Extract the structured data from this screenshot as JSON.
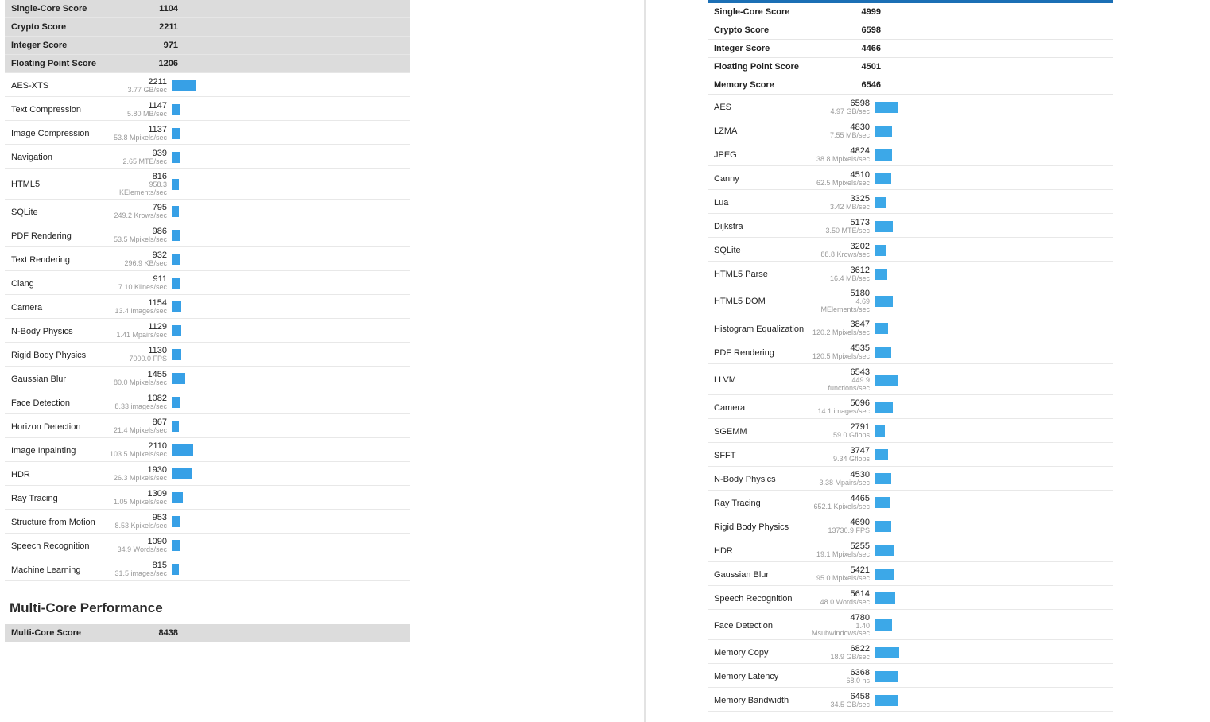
{
  "left": {
    "summary": [
      {
        "label": "Single-Core Score",
        "value": "1104"
      },
      {
        "label": "Crypto Score",
        "value": "2211"
      },
      {
        "label": "Integer Score",
        "value": "971"
      },
      {
        "label": "Floating Point Score",
        "value": "1206"
      }
    ],
    "benchmarks": [
      {
        "name": "AES-XTS",
        "score": "2211",
        "unit": "3.77 GB/sec",
        "bar": 30
      },
      {
        "name": "Text Compression",
        "score": "1147",
        "unit": "5.80 MB/sec",
        "bar": 11
      },
      {
        "name": "Image Compression",
        "score": "1137",
        "unit": "53.8 Mpixels/sec",
        "bar": 11
      },
      {
        "name": "Navigation",
        "score": "939",
        "unit": "2.65 MTE/sec",
        "bar": 11
      },
      {
        "name": "HTML5",
        "score": "816",
        "unit": "958.3 KElements/sec",
        "bar": 9
      },
      {
        "name": "SQLite",
        "score": "795",
        "unit": "249.2 Krows/sec",
        "bar": 9
      },
      {
        "name": "PDF Rendering",
        "score": "986",
        "unit": "53.5 Mpixels/sec",
        "bar": 11
      },
      {
        "name": "Text Rendering",
        "score": "932",
        "unit": "296.9 KB/sec",
        "bar": 11
      },
      {
        "name": "Clang",
        "score": "911",
        "unit": "7.10 Klines/sec",
        "bar": 11
      },
      {
        "name": "Camera",
        "score": "1154",
        "unit": "13.4 images/sec",
        "bar": 12
      },
      {
        "name": "N-Body Physics",
        "score": "1129",
        "unit": "1.41 Mpairs/sec",
        "bar": 12
      },
      {
        "name": "Rigid Body Physics",
        "score": "1130",
        "unit": "7000.0 FPS",
        "bar": 12
      },
      {
        "name": "Gaussian Blur",
        "score": "1455",
        "unit": "80.0 Mpixels/sec",
        "bar": 17
      },
      {
        "name": "Face Detection",
        "score": "1082",
        "unit": "8.33 images/sec",
        "bar": 11
      },
      {
        "name": "Horizon Detection",
        "score": "867",
        "unit": "21.4 Mpixels/sec",
        "bar": 9
      },
      {
        "name": "Image Inpainting",
        "score": "2110",
        "unit": "103.5 Mpixels/sec",
        "bar": 27
      },
      {
        "name": "HDR",
        "score": "1930",
        "unit": "26.3 Mpixels/sec",
        "bar": 25
      },
      {
        "name": "Ray Tracing",
        "score": "1309",
        "unit": "1.05 Mpixels/sec",
        "bar": 14
      },
      {
        "name": "Structure from Motion",
        "score": "953",
        "unit": "8.53 Kpixels/sec",
        "bar": 11
      },
      {
        "name": "Speech Recognition",
        "score": "1090",
        "unit": "34.9 Words/sec",
        "bar": 11
      },
      {
        "name": "Machine Learning",
        "score": "815",
        "unit": "31.5 images/sec",
        "bar": 9
      }
    ],
    "multi_title": "Multi-Core Performance",
    "multi_summary": [
      {
        "label": "Multi-Core Score",
        "value": "8438"
      }
    ]
  },
  "right": {
    "summary": [
      {
        "label": "Single-Core Score",
        "value": "4999"
      },
      {
        "label": "Crypto Score",
        "value": "6598"
      },
      {
        "label": "Integer Score",
        "value": "4466"
      },
      {
        "label": "Floating Point Score",
        "value": "4501"
      },
      {
        "label": "Memory Score",
        "value": "6546"
      }
    ],
    "benchmarks": [
      {
        "name": "AES",
        "score": "6598",
        "unit": "4.97 GB/sec",
        "bar": 30
      },
      {
        "name": "LZMA",
        "score": "4830",
        "unit": "7.55 MB/sec",
        "bar": 22
      },
      {
        "name": "JPEG",
        "score": "4824",
        "unit": "38.8 Mpixels/sec",
        "bar": 22
      },
      {
        "name": "Canny",
        "score": "4510",
        "unit": "62.5 Mpixels/sec",
        "bar": 21
      },
      {
        "name": "Lua",
        "score": "3325",
        "unit": "3.42 MB/sec",
        "bar": 15
      },
      {
        "name": "Dijkstra",
        "score": "5173",
        "unit": "3.50 MTE/sec",
        "bar": 23
      },
      {
        "name": "SQLite",
        "score": "3202",
        "unit": "88.8 Krows/sec",
        "bar": 15
      },
      {
        "name": "HTML5 Parse",
        "score": "3612",
        "unit": "16.4 MB/sec",
        "bar": 16
      },
      {
        "name": "HTML5 DOM",
        "score": "5180",
        "unit": "4.69 MElements/sec",
        "bar": 23
      },
      {
        "name": "Histogram Equalization",
        "score": "3847",
        "unit": "120.2 Mpixels/sec",
        "bar": 17
      },
      {
        "name": "PDF Rendering",
        "score": "4535",
        "unit": "120.5 Mpixels/sec",
        "bar": 21
      },
      {
        "name": "LLVM",
        "score": "6543",
        "unit": "449.9 functions/sec",
        "bar": 30
      },
      {
        "name": "Camera",
        "score": "5096",
        "unit": "14.1 images/sec",
        "bar": 23
      },
      {
        "name": "SGEMM",
        "score": "2791",
        "unit": "59.0 Gflops",
        "bar": 13
      },
      {
        "name": "SFFT",
        "score": "3747",
        "unit": "9.34 Gflops",
        "bar": 17
      },
      {
        "name": "N-Body Physics",
        "score": "4530",
        "unit": "3.38 Mpairs/sec",
        "bar": 21
      },
      {
        "name": "Ray Tracing",
        "score": "4465",
        "unit": "652.1 Kpixels/sec",
        "bar": 20
      },
      {
        "name": "Rigid Body Physics",
        "score": "4690",
        "unit": "13730.9 FPS",
        "bar": 21
      },
      {
        "name": "HDR",
        "score": "5255",
        "unit": "19.1 Mpixels/sec",
        "bar": 24
      },
      {
        "name": "Gaussian Blur",
        "score": "5421",
        "unit": "95.0 Mpixels/sec",
        "bar": 25
      },
      {
        "name": "Speech Recognition",
        "score": "5614",
        "unit": "48.0 Words/sec",
        "bar": 26
      },
      {
        "name": "Face Detection",
        "score": "4780",
        "unit": "1.40 Msubwindows/sec",
        "bar": 22
      },
      {
        "name": "Memory Copy",
        "score": "6822",
        "unit": "18.9 GB/sec",
        "bar": 31
      },
      {
        "name": "Memory Latency",
        "score": "6368",
        "unit": "68.0 ns",
        "bar": 29
      },
      {
        "name": "Memory Bandwidth",
        "score": "6458",
        "unit": "34.5 GB/sec",
        "bar": 29
      }
    ]
  }
}
